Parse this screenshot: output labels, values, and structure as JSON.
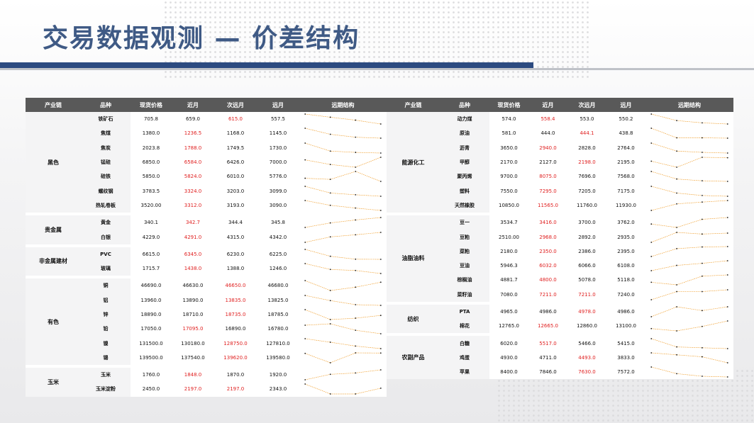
{
  "page": {
    "title": "交易数据观测 — 价差结构"
  },
  "headers": [
    "产业链",
    "品种",
    "现货价格",
    "近月",
    "次远月",
    "远月",
    "远期结构"
  ],
  "colors": {
    "title": "#3f5a85",
    "header_bg": "#595959",
    "highlight": "#e02020",
    "line": "#f0a030",
    "point": "#222222"
  },
  "left_groups": [
    {
      "category": "黑色",
      "rows": [
        {
          "product": "铁矿石",
          "spot": "705.8",
          "near": "659.0",
          "next": "615.0",
          "far": "557.5",
          "red": [
            "next"
          ]
        },
        {
          "product": "焦煤",
          "spot": "1380.0",
          "near": "1236.5",
          "next": "1168.0",
          "far": "1145.0",
          "red": [
            "near"
          ]
        },
        {
          "product": "焦炭",
          "spot": "2023.8",
          "near": "1788.0",
          "next": "1749.5",
          "far": "1730.0",
          "red": [
            "near"
          ]
        },
        {
          "product": "锰硅",
          "spot": "6850.0",
          "near": "6584.0",
          "next": "6426.0",
          "far": "7000.0",
          "red": [
            "near"
          ]
        },
        {
          "product": "硅铁",
          "spot": "5850.0",
          "near": "5824.0",
          "next": "6010.0",
          "far": "5776.0",
          "red": [
            "near"
          ]
        },
        {
          "product": "螺纹钢",
          "spot": "3783.5",
          "near": "3324.0",
          "next": "3203.0",
          "far": "3099.0",
          "red": [
            "near"
          ]
        },
        {
          "product": "热轧卷板",
          "spot": "3520.00",
          "near": "3312.0",
          "next": "3193.0",
          "far": "3090.0",
          "red": [
            "near"
          ]
        }
      ]
    },
    {
      "category": "贵金属",
      "rows": [
        {
          "product": "黄金",
          "spot": "340.1",
          "near": "342.7",
          "next": "344.4",
          "far": "345.8",
          "red": [
            "near"
          ]
        },
        {
          "product": "白银",
          "spot": "4229.0",
          "near": "4291.0",
          "next": "4315.0",
          "far": "4342.0",
          "red": [
            "near"
          ]
        }
      ]
    },
    {
      "category": "非金属建材",
      "rows": [
        {
          "product": "PVC",
          "spot": "6615.0",
          "near": "6345.0",
          "next": "6230.0",
          "far": "6225.0",
          "red": [
            "near"
          ]
        },
        {
          "product": "玻璃",
          "spot": "1715.7",
          "near": "1438.0",
          "next": "1388.0",
          "far": "1246.0",
          "red": [
            "near"
          ]
        }
      ]
    },
    {
      "category": "有色",
      "rows": [
        {
          "product": "铜",
          "spot": "46690.0",
          "near": "46630.0",
          "next": "46650.0",
          "far": "46680.0",
          "red": [
            "next"
          ]
        },
        {
          "product": "铝",
          "spot": "13960.0",
          "near": "13890.0",
          "next": "13835.0",
          "far": "13825.0",
          "red": [
            "next"
          ]
        },
        {
          "product": "锌",
          "spot": "18890.0",
          "near": "18710.0",
          "next": "18735.0",
          "far": "18785.0",
          "red": [
            "next"
          ]
        },
        {
          "product": "铅",
          "spot": "17050.0",
          "near": "17095.0",
          "next": "16890.0",
          "far": "16780.0",
          "red": [
            "near"
          ]
        },
        {
          "product": "镍",
          "spot": "131500.0",
          "near": "130180.0",
          "next": "128750.0",
          "far": "127810.0",
          "red": [
            "next"
          ]
        },
        {
          "product": "锡",
          "spot": "139500.0",
          "near": "137540.0",
          "next": "139620.0",
          "far": "139580.0",
          "red": [
            "next"
          ]
        }
      ]
    },
    {
      "category": "玉米",
      "rows": [
        {
          "product": "玉米",
          "spot": "1760.0",
          "near": "1848.0",
          "next": "1870.0",
          "far": "1920.0",
          "red": [
            "near"
          ]
        },
        {
          "product": "玉米淀粉",
          "spot": "2450.0",
          "near": "2197.0",
          "next": "2197.0",
          "far": "2343.0",
          "red": [
            "near",
            "next"
          ]
        }
      ]
    }
  ],
  "right_groups": [
    {
      "category": "能源化工",
      "rows": [
        {
          "product": "动力煤",
          "spot": "574.0",
          "near": "558.4",
          "next": "553.0",
          "far": "550.2",
          "red": [
            "near"
          ]
        },
        {
          "product": "原油",
          "spot": "581.0",
          "near": "444.0",
          "next": "444.1",
          "far": "438.8",
          "red": [
            "next"
          ]
        },
        {
          "product": "沥青",
          "spot": "3650.0",
          "near": "2940.0",
          "next": "2828.0",
          "far": "2764.0",
          "red": [
            "near"
          ]
        },
        {
          "product": "甲醇",
          "spot": "2170.0",
          "near": "2127.0",
          "next": "2198.0",
          "far": "2195.0",
          "red": [
            "next"
          ]
        },
        {
          "product": "聚丙烯",
          "spot": "9700.0",
          "near": "8075.0",
          "next": "7696.0",
          "far": "7568.0",
          "red": [
            "near"
          ]
        },
        {
          "product": "塑料",
          "spot": "7550.0",
          "near": "7295.0",
          "next": "7205.0",
          "far": "7175.0",
          "red": [
            "near"
          ]
        },
        {
          "product": "天然橡胶",
          "spot": "10850.0",
          "near": "11565.0",
          "next": "11760.0",
          "far": "11930.0",
          "red": [
            "near"
          ]
        }
      ]
    },
    {
      "category": "油脂油料",
      "rows": [
        {
          "product": "豆一",
          "spot": "3534.7",
          "near": "3416.0",
          "next": "3700.0",
          "far": "3762.0",
          "red": [
            "near"
          ]
        },
        {
          "product": "豆粕",
          "spot": "2510.00",
          "near": "2968.0",
          "next": "2892.0",
          "far": "2935.0",
          "red": [
            "near"
          ]
        },
        {
          "product": "菜粕",
          "spot": "2180.0",
          "near": "2350.0",
          "next": "2386.0",
          "far": "2395.0",
          "red": [
            "near"
          ]
        },
        {
          "product": "豆油",
          "spot": "5946.3",
          "near": "6032.0",
          "next": "6066.0",
          "far": "6108.0",
          "red": [
            "near"
          ]
        },
        {
          "product": "棕榈油",
          "spot": "4881.7",
          "near": "4800.0",
          "next": "5078.0",
          "far": "5118.0",
          "red": [
            "near"
          ]
        },
        {
          "product": "菜籽油",
          "spot": "7080.0",
          "near": "7211.0",
          "next": "7211.0",
          "far": "7240.0",
          "red": [
            "near",
            "next"
          ]
        }
      ]
    },
    {
      "category": "纺织",
      "rows": [
        {
          "product": "PTA",
          "spot": "4965.0",
          "near": "4986.0",
          "next": "4978.0",
          "far": "4986.0",
          "red": [
            "next"
          ]
        },
        {
          "product": "棉花",
          "spot": "12765.0",
          "near": "12665.0",
          "next": "12860.0",
          "far": "13100.0",
          "red": [
            "near"
          ]
        }
      ]
    },
    {
      "category": "农副产品",
      "rows": [
        {
          "product": "白糖",
          "spot": "6020.0",
          "near": "5517.0",
          "next": "5466.0",
          "far": "5415.0",
          "red": [
            "near"
          ]
        },
        {
          "product": "鸡蛋",
          "spot": "4930.0",
          "near": "4711.0",
          "next": "4493.0",
          "far": "3833.0",
          "red": [
            "next"
          ]
        },
        {
          "product": "苹果",
          "spot": "8400.0",
          "near": "7846.0",
          "next": "7630.0",
          "far": "7572.0",
          "red": [
            "next"
          ]
        }
      ]
    }
  ]
}
